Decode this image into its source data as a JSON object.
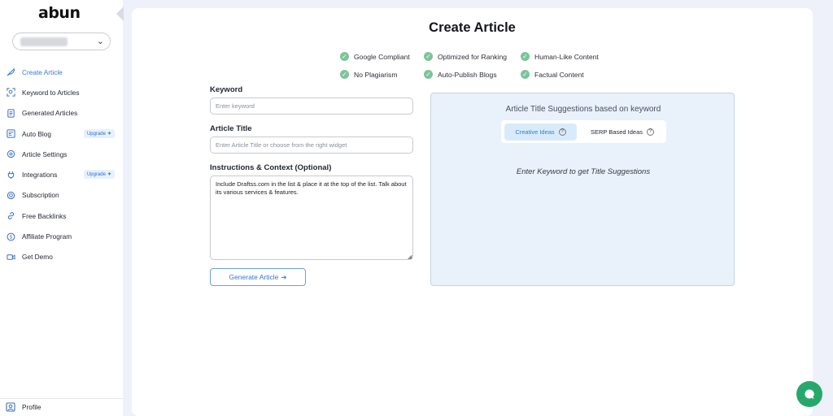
{
  "app": {
    "logo": "abun"
  },
  "sidebar": {
    "workspace_value": "",
    "items": [
      {
        "label": "Create Article",
        "icon": "feather-icon",
        "active": true
      },
      {
        "label": "Keyword to Articles",
        "icon": "keyword-scan-icon"
      },
      {
        "label": "Generated Articles",
        "icon": "document-icon"
      },
      {
        "label": "Auto Blog",
        "icon": "blog-icon",
        "badge": "Upgrade"
      },
      {
        "label": "Article Settings",
        "icon": "settings-gear-icon"
      },
      {
        "label": "Integrations",
        "icon": "plug-icon",
        "badge": "Upgrade"
      },
      {
        "label": "Subscription",
        "icon": "subscription-icon"
      },
      {
        "label": "Free Backlinks",
        "icon": "link-icon"
      },
      {
        "label": "Affiliate Program",
        "icon": "dollar-icon"
      },
      {
        "label": "Get Demo",
        "icon": "video-icon"
      }
    ],
    "profile_label": "Profile"
  },
  "main": {
    "title": "Create Article",
    "features": [
      "Google Compliant",
      "Optimized for Ranking",
      "Human-Like Content",
      "No Plagiarism",
      "Auto-Publish Blogs",
      "Factual Content"
    ],
    "keyword": {
      "label": "Keyword",
      "placeholder": "Enter keyword",
      "value": ""
    },
    "article_title": {
      "label": "Article Title",
      "placeholder": "Enter Article Title or choose from the right widget",
      "value": ""
    },
    "instructions": {
      "label": "Instructions & Context (Optional)",
      "value": "Include Draftss.com in the list & place it at the top of the list. Talk about its various services & features."
    },
    "generate_button": "Generate Article",
    "generate_arrow": "➔"
  },
  "suggestions": {
    "title": "Article Title Suggestions based on keyword",
    "tabs": [
      {
        "label": "Creative Ideas",
        "active": true
      },
      {
        "label": "SERP Based Ideas",
        "active": false
      }
    ],
    "help_glyph": "?",
    "empty_text": "Enter Keyword to get Title Suggestions"
  },
  "colors": {
    "accent": "#3b7ae0",
    "check_green": "#7cc49a",
    "chat_green": "#26a86c",
    "panel_bg": "#e9f1fa"
  }
}
